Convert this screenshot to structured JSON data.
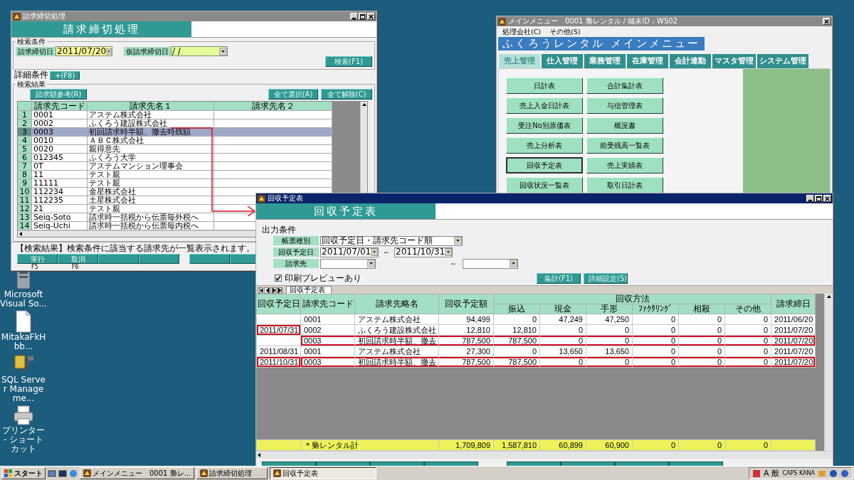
{
  "desktop_icons": [
    {
      "kind": "app",
      "label": "Microsoft Visual So..."
    },
    {
      "kind": "file",
      "label": "MitakaFkHbb..."
    },
    {
      "kind": "tool",
      "label": "SQL Server Manageme..."
    },
    {
      "kind": "printer",
      "label": "プリンター - ショートカット"
    }
  ],
  "billing_window": {
    "title": "請求締切処理",
    "active": false,
    "header": "請求締切処理",
    "search_group": "検索条件",
    "fields": [
      {
        "label": "請求締切日",
        "value": "2011/07/20",
        "kind": "set"
      },
      {
        "label": "仮請求締切日",
        "value": "/ /",
        "kind": "provisional"
      }
    ],
    "search_button": "検索(F1)",
    "detail_group": "詳細条件",
    "detail_button": "+(F8)",
    "results_group": "検索結果",
    "reference_button": "請求額参考(R)",
    "select_all_button": "全て選択(A)",
    "clear_all_button": "全て解除(C)",
    "columns": [
      "請求先コード",
      "請求先名１",
      "請求先名２"
    ],
    "rows": [
      {
        "number": "1",
        "code": "0001",
        "name": "アステム株式会社",
        "selected": false
      },
      {
        "number": "2",
        "code": "0002",
        "name": "ふくろう建設株式会社",
        "selected": false
      },
      {
        "number": "3",
        "code": "0003",
        "name": "初回請求時半額、撤去時残額",
        "selected": true
      },
      {
        "number": "4",
        "code": "0010",
        "name": "ＡＢＣ株式会社",
        "selected": false
      },
      {
        "number": "5",
        "code": "0020",
        "name": "親得意先",
        "selected": false
      },
      {
        "number": "6",
        "code": "012345",
        "name": "ふくろう大学",
        "selected": false
      },
      {
        "number": "7",
        "code": "0T",
        "name": "アステムマンション理事会",
        "selected": false
      },
      {
        "number": "8",
        "code": "11",
        "name": "テスト親",
        "selected": false
      },
      {
        "number": "9",
        "code": "11111",
        "name": "テスト親",
        "selected": false
      },
      {
        "number": "10",
        "code": "112234",
        "name": "金星株式会社",
        "selected": false
      },
      {
        "number": "11",
        "code": "112235",
        "name": "土星株式会社",
        "selected": false
      },
      {
        "number": "12",
        "code": "21",
        "name": "テスト親",
        "selected": false
      },
      {
        "number": "13",
        "code": "Seiq-Soto",
        "name": "請求時一括税から伝票毎外税へ",
        "selected": false
      },
      {
        "number": "14",
        "code": "Seiq-Uchi",
        "name": "請求時一括税から伝票毎内税へ",
        "selected": false
      }
    ],
    "status": "【検索結果】検索条件に該当する請求先が一覧表示されます。",
    "function_keys": [
      {
        "label": "実行",
        "key": "F5"
      },
      {
        "label": "取消",
        "key": "F6"
      }
    ]
  },
  "menu_window": {
    "title": "メインメニュー　0001 梟レンタル / 端末ID：WS02",
    "active": false,
    "menus": [
      "処理会社(C)",
      "その他(S)"
    ],
    "header": "ふくろうレンタル メインメニュー",
    "tabs": [
      {
        "label": "売上管理",
        "selected": true
      },
      {
        "label": "仕入管理",
        "selected": false
      },
      {
        "label": "業務管理",
        "selected": false
      },
      {
        "label": "在庫管理",
        "selected": false
      },
      {
        "label": "会計連動",
        "selected": false
      },
      {
        "label": "マスタ管理",
        "selected": false
      },
      {
        "label": "システム管理",
        "selected": false
      }
    ],
    "buttons": [
      {
        "label": "日計表",
        "focused": false
      },
      {
        "label": "合計集計表",
        "focused": false
      },
      {
        "label": "売上入金日計表",
        "focused": false
      },
      {
        "label": "与信管理表",
        "focused": false
      },
      {
        "label": "受注No別原価表",
        "focused": false
      },
      {
        "label": "概況書",
        "focused": false
      },
      {
        "label": "売上分析表",
        "focused": false
      },
      {
        "label": "前受残高一覧表",
        "focused": false
      },
      {
        "label": "回収予定表",
        "focused": true
      },
      {
        "label": "売上実績表",
        "focused": false
      },
      {
        "label": "回収状況一覧表",
        "focused": false
      },
      {
        "label": "取引日計表",
        "focused": false
      }
    ]
  },
  "report_window": {
    "title": "回収予定表",
    "active": true,
    "header": "回収予定表",
    "conditions_group": "出力条件",
    "report_type": {
      "label": "帳票種別",
      "value": "回収予定日・請求先コード順"
    },
    "date_range": {
      "label": "回収予定日",
      "from": "2011/07/01",
      "separator": "～",
      "to": "2011/10/31"
    },
    "customer_range": {
      "label": "請求先",
      "separator": "～"
    },
    "preview": {
      "label": "印刷プレビューあり",
      "checked": true
    },
    "buttons": [
      "集計(F1)",
      "詳細設定(S)"
    ],
    "sheet_tab": "回収予定表",
    "columns": [
      "回収予定日",
      "請求先コード",
      "請求先略名",
      "回収予定額"
    ],
    "method_group": "回収方法",
    "method_columns": [
      "振込",
      "現金",
      "手形",
      "ﾌｧｸﾀﾘﾝｸﾞ",
      "相殺",
      "その他"
    ],
    "last_column": "請求締日",
    "rows": [
      {
        "cells": [
          "",
          "0001",
          "アステム株式会社",
          "94,499",
          "0",
          "47,249",
          "47,250",
          "0",
          "0",
          "0",
          "2011/06/20"
        ],
        "date_marked": false,
        "row_marked": false
      },
      {
        "cells": [
          "2011/07/31",
          "0002",
          "ふくろう建設株式会社",
          "12,810",
          "12,810",
          "0",
          "0",
          "0",
          "0",
          "0",
          "2011/07/20"
        ],
        "date_marked": true,
        "row_marked": false
      },
      {
        "cells": [
          "",
          "0003",
          "初回請求時半額、撤去",
          "787,500",
          "787,500",
          "0",
          "0",
          "0",
          "0",
          "0",
          "2011/07/20"
        ],
        "date_marked": false,
        "row_marked": true
      },
      {
        "cells": [
          "2011/08/31",
          "0001",
          "アステム株式会社",
          "27,300",
          "0",
          "13,650",
          "13,650",
          "0",
          "0",
          "0",
          "2011/07/20"
        ],
        "date_marked": false,
        "row_marked": false
      },
      {
        "cells": [
          "2011/10/31",
          "0003",
          "初回請求時半額、撤去",
          "787,500",
          "787,500",
          "0",
          "0",
          "0",
          "0",
          "0",
          "2011/07/20"
        ],
        "date_marked": true,
        "row_marked": true
      }
    ],
    "total": {
      "label": "＊梟レンタル計",
      "values": [
        "1,709,809",
        "1,587,810",
        "60,899",
        "60,900",
        "0",
        "0",
        "0"
      ]
    }
  },
  "taskbar": {
    "start": "スタート",
    "tasks": [
      {
        "label": "メインメニュー　0001 梟レ...",
        "selected": false
      },
      {
        "label": "請求締切処理",
        "selected": false
      },
      {
        "label": "回収予定表",
        "selected": true
      }
    ],
    "tray_texts": [
      "A",
      "般",
      "CAPS KANA"
    ]
  }
}
